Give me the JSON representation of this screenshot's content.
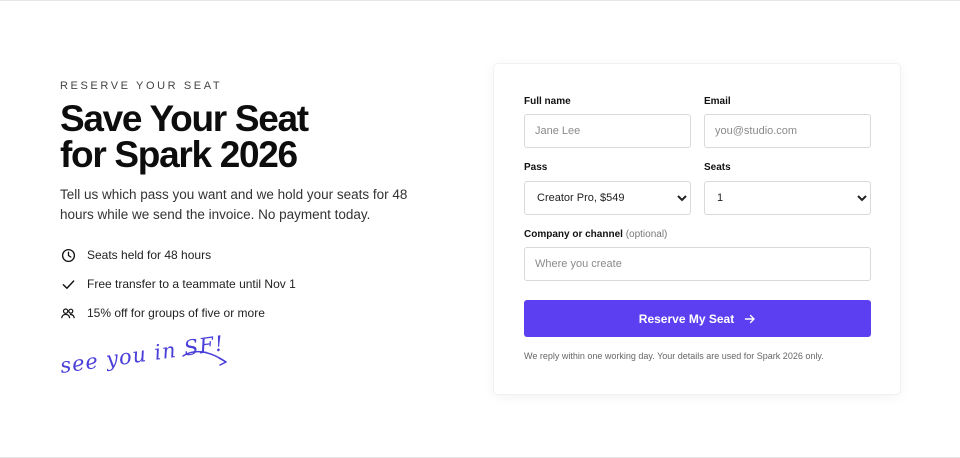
{
  "hero": {
    "eyebrow": "RESERVE YOUR SEAT",
    "headline_line1": "Save Your Seat",
    "headline_line2": "for Spark 2026",
    "description": "Tell us which pass you want and we hold your seats for 48 hours while we send the invoice. No payment today.",
    "perks": [
      {
        "icon": "clock-icon",
        "text": "Seats held for 48 hours"
      },
      {
        "icon": "check-icon",
        "text": "Free transfer to a teammate until Nov 1"
      },
      {
        "icon": "group-icon",
        "text": "15% off for groups of five or more"
      }
    ],
    "scribble": "see you in SF!"
  },
  "form": {
    "full_name": {
      "label": "Full name",
      "placeholder": "Jane Lee"
    },
    "email": {
      "label": "Email",
      "placeholder": "you@studio.com"
    },
    "pass": {
      "label": "Pass",
      "selected": "Creator Pro, $549"
    },
    "seats": {
      "label": "Seats",
      "selected": "1"
    },
    "company": {
      "label": "Company or channel",
      "optional": "(optional)",
      "placeholder": "Where you create"
    },
    "submit_label": "Reserve My Seat",
    "note": "We reply within one working day. Your details are used for Spark 2026 only."
  },
  "colors": {
    "accent": "#5b3ff0",
    "scribble": "#4a3fd8"
  }
}
